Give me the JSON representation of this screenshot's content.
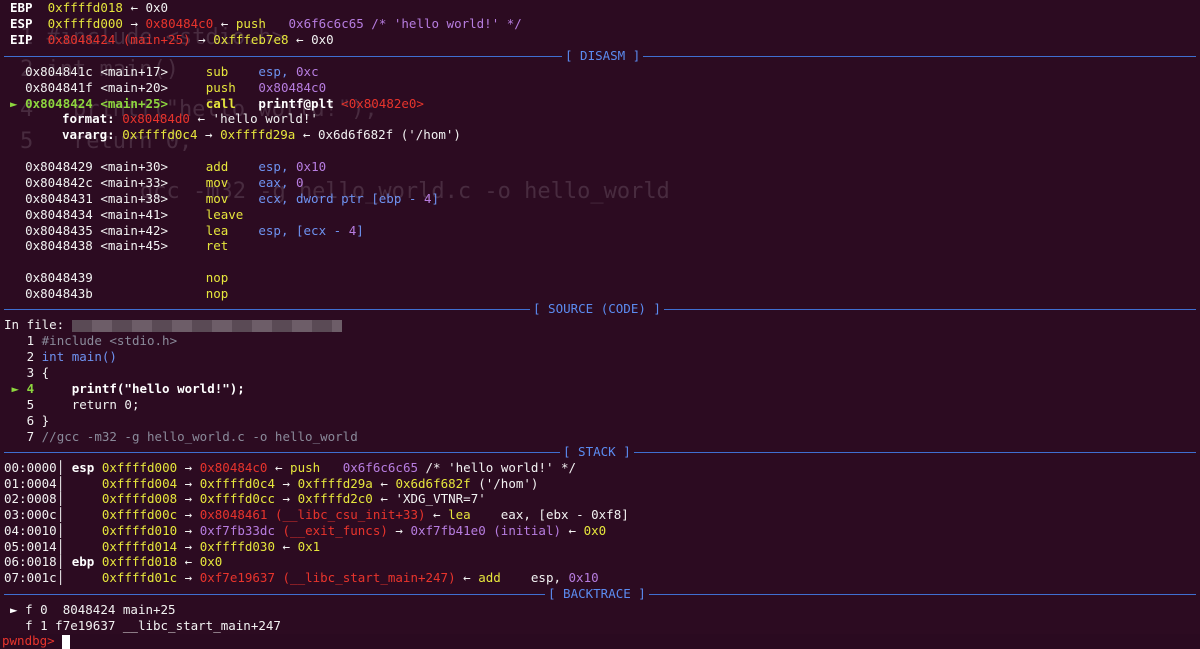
{
  "regs": {
    "ebp": {
      "name": "EBP",
      "addr": "0xffffd018",
      "arrow": "←",
      "val": "0x0"
    },
    "esp": {
      "name": "ESP",
      "addr": "0xffffd000",
      "arrow1": "→",
      "ptr": "0x80484c0",
      "arrow2": "←",
      "ins": "push",
      "arg": "0x6f6c6c65 /* 'hello world!' */"
    },
    "eip": {
      "name": "EIP",
      "addr": "0x8048424",
      "sym": "(main+25)",
      "arrow1": "→",
      "ptr": "0xfffeb7e8",
      "arrow2": "←",
      "val": "0x0"
    }
  },
  "sections": {
    "disasm": "[ DISASM ]",
    "source": "[ SOURCE (CODE) ]",
    "stack": "[ STACK ]",
    "backtrace": "[ BACKTRACE ]"
  },
  "disasm": [
    {
      "addr": "0x804841c",
      "sym": "<main+17>",
      "op": "sub",
      "args": "esp, 0xc"
    },
    {
      "addr": "0x804841f",
      "sym": "<main+20>",
      "op": "push",
      "args": "0x80484c0"
    },
    {
      "addr": "0x8048424",
      "sym": "<main+25>",
      "op": "call",
      "args": "printf@plt",
      "target": "<0x80482e0>",
      "current": true
    },
    {
      "addr": "0x8048429",
      "sym": "<main+30>",
      "op": "add",
      "args": "esp, 0x10"
    },
    {
      "addr": "0x804842c",
      "sym": "<main+33>",
      "op": "mov",
      "args": "eax, 0"
    },
    {
      "addr": "0x8048431",
      "sym": "<main+38>",
      "op": "mov",
      "args": "ecx, dword ptr [ebp - 4]"
    },
    {
      "addr": "0x8048434",
      "sym": "<main+41>",
      "op": "leave",
      "args": ""
    },
    {
      "addr": "0x8048435",
      "sym": "<main+42>",
      "op": "lea",
      "args": "esp, [ecx - 4]"
    },
    {
      "addr": "0x8048438",
      "sym": "<main+45>",
      "op": "ret",
      "args": ""
    },
    {
      "addr": "0x8048439",
      "sym": "",
      "op": "nop",
      "args": ""
    },
    {
      "addr": "0x804843b",
      "sym": "",
      "op": "nop",
      "args": ""
    }
  ],
  "call_args": {
    "format": {
      "label": "format:",
      "ptr": "0x80484d0",
      "arrow": "←",
      "val": "'hello world!'"
    },
    "vararg": {
      "label": "vararg:",
      "ptr": "0xffffd0c4",
      "arrow1": "→",
      "ptr2": "0xffffd29a",
      "arrow2": "←",
      "val": "0x6d6f682f ('/hom')"
    }
  },
  "current_marker": "►",
  "source": {
    "infile": "In file:",
    "lines": [
      {
        "n": "1",
        "code": "#include <stdio.h>"
      },
      {
        "n": "2",
        "code": "int main()"
      },
      {
        "n": "3",
        "code": "{"
      },
      {
        "n": "4",
        "code": "    printf(\"hello world!\");",
        "current": true
      },
      {
        "n": "5",
        "code": "    return 0;"
      },
      {
        "n": "6",
        "code": "}"
      },
      {
        "n": "7",
        "code": "//gcc -m32 -g hello_world.c -o hello_world"
      }
    ]
  },
  "stack": [
    {
      "off": "00:0000",
      "reg": "esp",
      "chain": "0xffffd000 → 0x80484c0 ← push   0x6f6c6c65 /* 'hello world!' */"
    },
    {
      "off": "01:0004",
      "reg": "",
      "chain": "0xffffd004 → 0xffffd0c4 → 0xffffd29a ← 0x6d6f682f ('/hom')"
    },
    {
      "off": "02:0008",
      "reg": "",
      "chain": "0xffffd008 → 0xffffd0cc → 0xffffd2c0 ← 'XDG_VTNR=7'"
    },
    {
      "off": "03:000c",
      "reg": "",
      "chain": "0xffffd00c → 0x8048461 (__libc_csu_init+33) ← lea    eax, [ebx - 0xf8]"
    },
    {
      "off": "04:0010",
      "reg": "",
      "chain": "0xffffd010 → 0xf7fb33dc (__exit_funcs) → 0xf7fb41e0 (initial) ← 0x0"
    },
    {
      "off": "05:0014",
      "reg": "",
      "chain": "0xffffd014 → 0xffffd030 ← 0x1"
    },
    {
      "off": "06:0018",
      "reg": "ebp",
      "chain": "0xffffd018 ← 0x0"
    },
    {
      "off": "07:001c",
      "reg": "",
      "chain": "0xffffd01c → 0xf7e19637 (__libc_start_main+247) ← add    esp, 0x10"
    }
  ],
  "backtrace": [
    {
      "marker": "►",
      "text": "f 0  8048424 main+25"
    },
    {
      "marker": "",
      "text": "f 1 f7e19637 __libc_start_main+247"
    }
  ],
  "prompt": "pwndbg>",
  "ghost": {
    "l1": "1 #include <stdio.h>",
    "l2": "2 int main()",
    "l3": "4   printf(\"hello world!\");",
    "l4": "5   return 0;",
    "l5": "gcc -m32 -g hello_world.c -o hello_world"
  }
}
